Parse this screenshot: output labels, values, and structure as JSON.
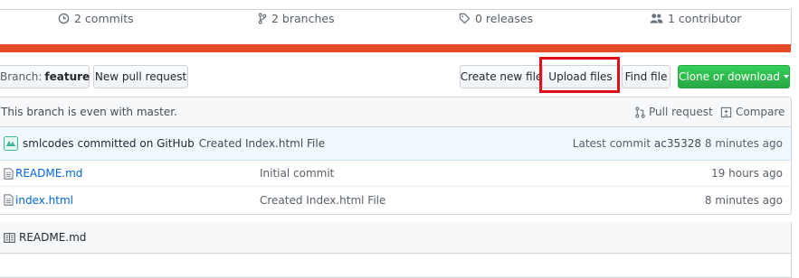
{
  "summary": {
    "commits": "2 commits",
    "branches": "2 branches",
    "releases": "0 releases",
    "contributors": "1 contributor"
  },
  "language_bar_color": "#e34c26",
  "toolbar": {
    "branch_label": "Branch:",
    "branch_value": "feature",
    "new_pull_request": "New pull request",
    "create_new_file": "Create new file",
    "upload_files": "Upload files",
    "find_file": "Find file",
    "clone_or_download": "Clone or download",
    "accent_green": "#28a745",
    "highlight_color": "#e0101b"
  },
  "branch_status": {
    "text": "This branch is even with master.",
    "pull_request": "Pull request",
    "compare": "Compare"
  },
  "commit": {
    "author": "smlcodes",
    "action": "committed on GitHub",
    "message": "Created Index.html File",
    "latest_label": "Latest commit",
    "sha": "ac35328",
    "age": "8 minutes ago"
  },
  "files": [
    {
      "name": "README.md",
      "message": "Initial commit",
      "age": "19 hours ago",
      "icon": "file-icon"
    },
    {
      "name": "index.html",
      "message": "Created Index.html File",
      "age": "8 minutes ago",
      "icon": "file-icon"
    }
  ],
  "readme": {
    "title": "README.md",
    "icon": "book-icon"
  }
}
